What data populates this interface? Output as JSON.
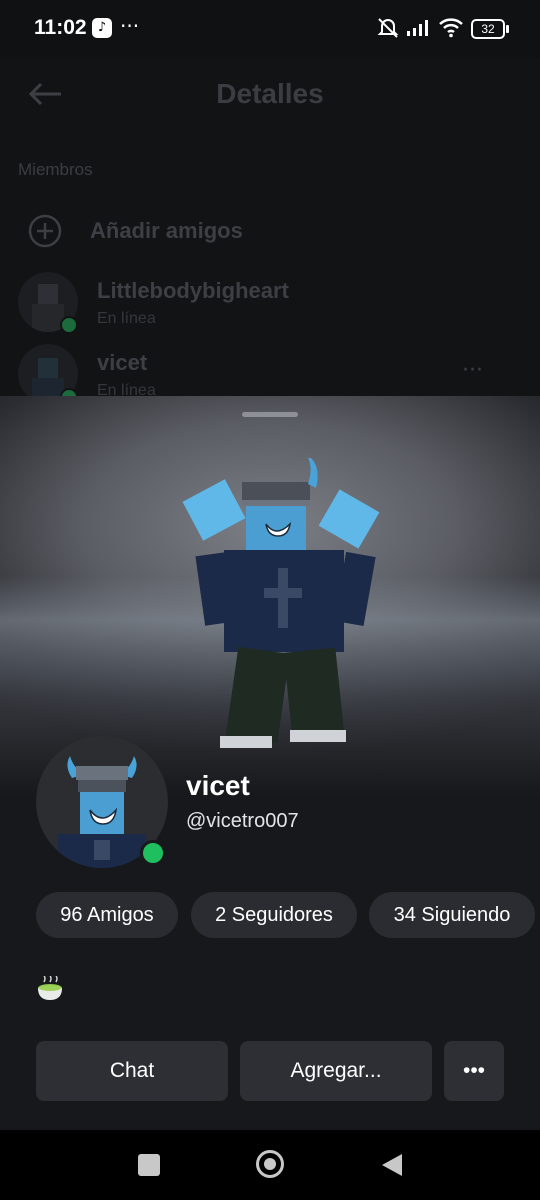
{
  "status_bar": {
    "time": "11:02",
    "notification_icon": "tiktok-icon",
    "more": "···",
    "battery": "32",
    "icons": [
      "mute-icon",
      "signal-icon",
      "wifi-icon",
      "battery-icon"
    ]
  },
  "background_page": {
    "title": "Detalles",
    "section_label": "Miembros",
    "add_friends_label": "Añadir amigos",
    "members": [
      {
        "name": "Littlebodybigheart",
        "status": "En línea"
      },
      {
        "name": "vicet",
        "status": "En línea",
        "more": "···"
      }
    ]
  },
  "profile": {
    "display_name": "vicet",
    "username": "@vicetro007",
    "stats": [
      {
        "label": "96 Amigos"
      },
      {
        "label": "2 Seguidores"
      },
      {
        "label": "34 Siguiendo"
      }
    ],
    "bio_icon": "matcha-bowl-emoji",
    "online_color": "#1fbf5f"
  },
  "actions": {
    "chat": "Chat",
    "add": "Agregar...",
    "more": "•••"
  },
  "nav_bar": {
    "icons": [
      "recent-apps-icon",
      "home-icon",
      "back-icon"
    ]
  }
}
